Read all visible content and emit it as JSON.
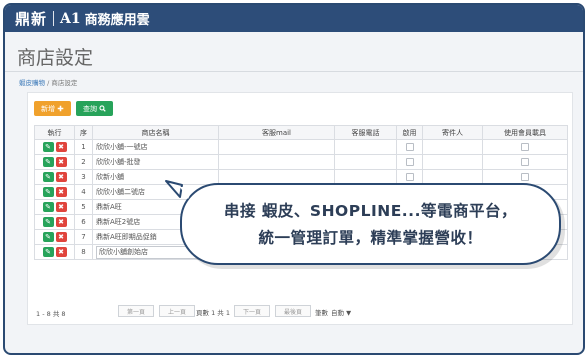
{
  "app": {
    "logo_mark": "鼎新",
    "logo_a1": "A1",
    "name": "商務應用雲"
  },
  "page": {
    "title": "商店設定",
    "breadcrumb": {
      "home": "蝦皮購物",
      "separator": "/",
      "current": "商店設定"
    }
  },
  "toolbar": {
    "add_label": "新增",
    "add_icon": "plus-icon",
    "query_label": "查詢",
    "query_icon": "search-icon"
  },
  "table": {
    "headers": [
      "執行",
      "序",
      "商店名稱",
      "客服mail",
      "客服電話",
      "啟用",
      "寄件人",
      "使用會員載具"
    ],
    "rows": [
      {
        "no": "1",
        "name": "欣欣小舖-一號店"
      },
      {
        "no": "2",
        "name": "欣欣小舖-批發"
      },
      {
        "no": "3",
        "name": "欣新小舖"
      },
      {
        "no": "4",
        "name": "欣欣小舖二號店"
      },
      {
        "no": "5",
        "name": "鼎新A旺"
      },
      {
        "no": "6",
        "name": "鼎新A旺2號店"
      },
      {
        "no": "7",
        "name": "鼎新A旺即期品促銷"
      },
      {
        "no": "8",
        "name": "欣欣小舖創始店"
      }
    ]
  },
  "pager": {
    "count": "1 - 8 共 8",
    "first": "第一頁",
    "prev": "上一頁",
    "page_info": "頁數 1 共 1",
    "next": "下一頁",
    "last": "最後頁",
    "size_label": "筆數",
    "size_value": "自動"
  },
  "callout": {
    "line1": "串接 蝦皮、SHOPLINE...等電商平台，",
    "line2": "統一管理訂單，精準掌握營收！"
  },
  "colors": {
    "appbar": "#2d4d79",
    "add_button": "#f0a12c",
    "query_button": "#27a35a",
    "edit_icon": "#27a35a",
    "delete_icon": "#e0443c"
  }
}
